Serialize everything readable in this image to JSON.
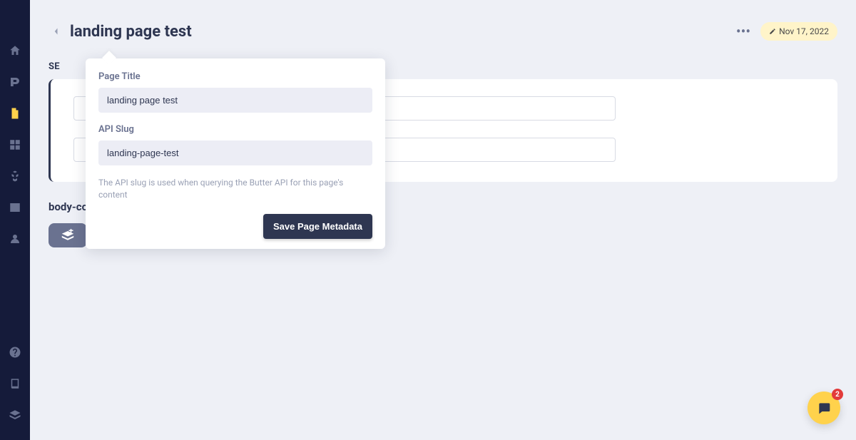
{
  "header": {
    "title": "landing page test",
    "date": "Nov 17, 2022"
  },
  "section_label": "SE",
  "card": {
    "field1_value": "",
    "field2_value": ""
  },
  "popover": {
    "title_label": "Page Title",
    "title_value": "landing page test",
    "slug_label": "API Slug",
    "slug_value": "landing-page-test",
    "help": "The API slug is used when querying the Butter API for this page's content",
    "save_label": "Save Page Metadata"
  },
  "body_component": {
    "label": "body-component"
  },
  "chat": {
    "badge": "2"
  }
}
